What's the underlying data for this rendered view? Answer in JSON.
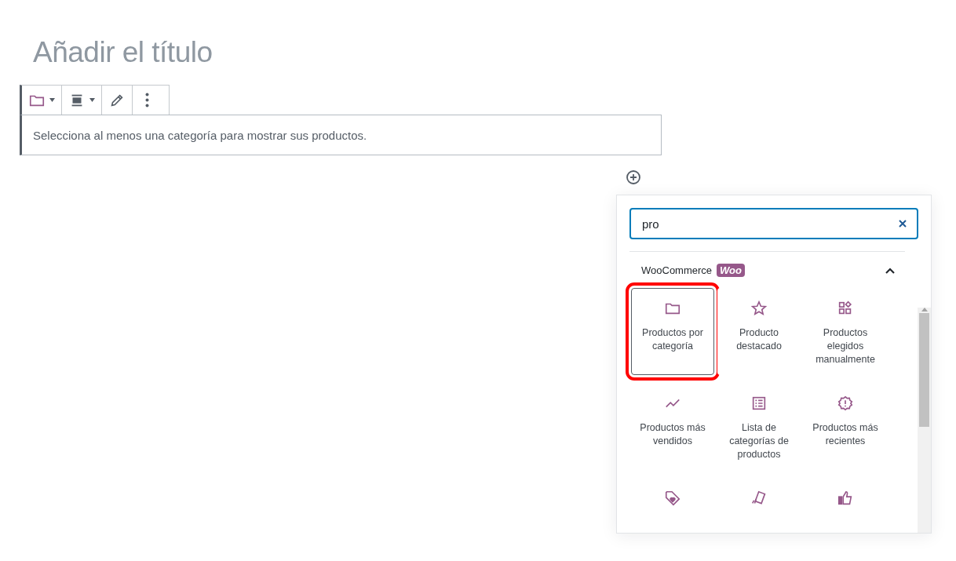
{
  "title_placeholder": "Añadir el título",
  "block_toolbar": [
    {
      "kind": "folder",
      "caret": true
    },
    {
      "kind": "align",
      "caret": true
    },
    {
      "kind": "pencil",
      "caret": false
    },
    {
      "kind": "more",
      "caret": false
    }
  ],
  "block_message": "Selecciona al menos una categoría para mostrar sus productos.",
  "inserter": {
    "search": {
      "value": "pro"
    },
    "section": {
      "title": "WooCommerce",
      "badge": "Woo",
      "expanded": true
    },
    "items": [
      {
        "kind": "folder",
        "label": "Productos por categoría",
        "selected": true
      },
      {
        "kind": "star",
        "label": "Producto destacado",
        "selected": false
      },
      {
        "kind": "grid",
        "label": "Productos elegidos manualmente",
        "selected": false
      },
      {
        "kind": "trend",
        "label": "Productos más vendidos",
        "selected": false
      },
      {
        "kind": "list",
        "label": "Lista de categorías de productos",
        "selected": false
      },
      {
        "kind": "badge",
        "label": "Productos más recientes",
        "selected": false
      },
      {
        "kind": "tag",
        "selected": false
      },
      {
        "kind": "cards",
        "selected": false
      },
      {
        "kind": "thumb",
        "selected": false
      }
    ]
  }
}
